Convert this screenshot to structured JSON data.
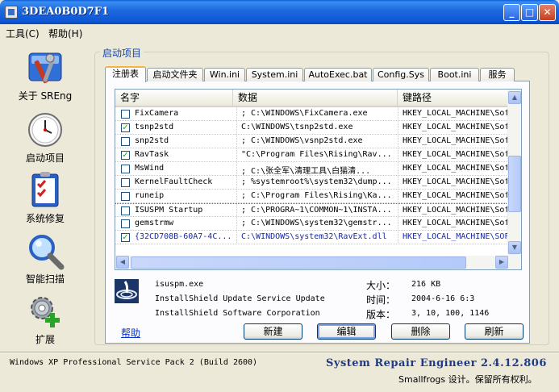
{
  "window": {
    "title": "3DEA0B0D7F1",
    "min": "_",
    "max": "□",
    "close": "✕"
  },
  "menu": [
    {
      "label": "工具(C)"
    },
    {
      "label": "帮助(H)"
    }
  ],
  "nav": [
    {
      "label": "关于 SREng",
      "icon": "tools-icon"
    },
    {
      "label": "启动项目",
      "icon": "clock-icon"
    },
    {
      "label": "系统修复",
      "icon": "checklist-icon"
    },
    {
      "label": "智能扫描",
      "icon": "magnifier-icon"
    },
    {
      "label": "扩展",
      "icon": "gear-plus-icon"
    }
  ],
  "group_title": "启动项目",
  "tabs": [
    {
      "label": "注册表",
      "active": true
    },
    {
      "label": "启动文件夹"
    },
    {
      "label": "Win.ini"
    },
    {
      "label": "System.ini"
    },
    {
      "label": "AutoExec.bat"
    },
    {
      "label": "Config.Sys"
    },
    {
      "label": "Boot.ini"
    },
    {
      "label": "服务"
    }
  ],
  "list": {
    "columns": [
      "名字",
      "数据",
      "键路径"
    ],
    "rows": [
      {
        "checked": false,
        "name": "FixCamera",
        "data": "; C:\\WINDOWS\\FixCamera.exe",
        "key": "HKEY_LOCAL_MACHINE\\Sof"
      },
      {
        "checked": true,
        "name": "tsnp2std",
        "data": "C:\\WINDOWS\\tsnp2std.exe",
        "key": "HKEY_LOCAL_MACHINE\\Sof"
      },
      {
        "checked": false,
        "name": "snp2std",
        "data": "; C:\\WINDOWS\\vsnp2std.exe",
        "key": "HKEY_LOCAL_MACHINE\\Sof"
      },
      {
        "checked": true,
        "name": "RavTask",
        "data": "\"C:\\Program Files\\Rising\\Rav...",
        "key": "HKEY_LOCAL_MACHINE\\Sof"
      },
      {
        "checked": false,
        "name": "MsWind",
        "data": "; C:\\张全军\\清理工具\\白猫清...",
        "key": "HKEY_LOCAL_MACHINE\\Sof"
      },
      {
        "checked": false,
        "name": "KernelFaultCheck",
        "data": "; %systemroot%\\system32\\dump...",
        "key": "HKEY_LOCAL_MACHINE\\Sof"
      },
      {
        "checked": false,
        "name": "runeip",
        "data": "; C:\\Program Files\\Rising\\Ka...",
        "key": "HKEY_LOCAL_MACHINE\\Sof"
      },
      {
        "checked": false,
        "name": "ISUSPM Startup",
        "data": "; C:\\PROGRA~1\\COMMON~1\\INSTA...",
        "key": "HKEY_LOCAL_MACHINE\\Sof",
        "selected": true
      },
      {
        "checked": false,
        "name": "gemstrmw",
        "data": "; C:\\WINDOWS\\system32\\gemstr...",
        "key": "HKEY_LOCAL_MACHINE\\Sof"
      },
      {
        "checked": true,
        "name": "{32CD708B-60A7-4C...",
        "data": "C:\\WINDOWS\\system32\\RavExt.dll",
        "key": "HKEY_LOCAL_MACHINE\\SOF",
        "blue": true
      }
    ]
  },
  "details": {
    "filename": "isuspm.exe",
    "description": "InstallShield Update Service Update",
    "company": "InstallShield Software Corporation",
    "size_label": "大小：",
    "size": "216 KB",
    "time_label": "时间：",
    "time": "2004-6-16 6:3",
    "version_label": "版本：",
    "version": "3, 10, 100, 1146"
  },
  "actions": {
    "help": "帮助",
    "new": "新建",
    "edit": "编辑",
    "delete": "删除",
    "refresh": "刷新"
  },
  "status": {
    "os": "Windows XP Professional Service Pack 2 (Build 2600)",
    "brand": "System Repair Engineer 2.4.12.806",
    "copyright": "Smallfrogs 设计。保留所有权利。"
  },
  "colors": {
    "title_bar": "#0d56d4",
    "brand": "#1e3a8a",
    "check": "#21a121",
    "link": "#0a32c8"
  }
}
